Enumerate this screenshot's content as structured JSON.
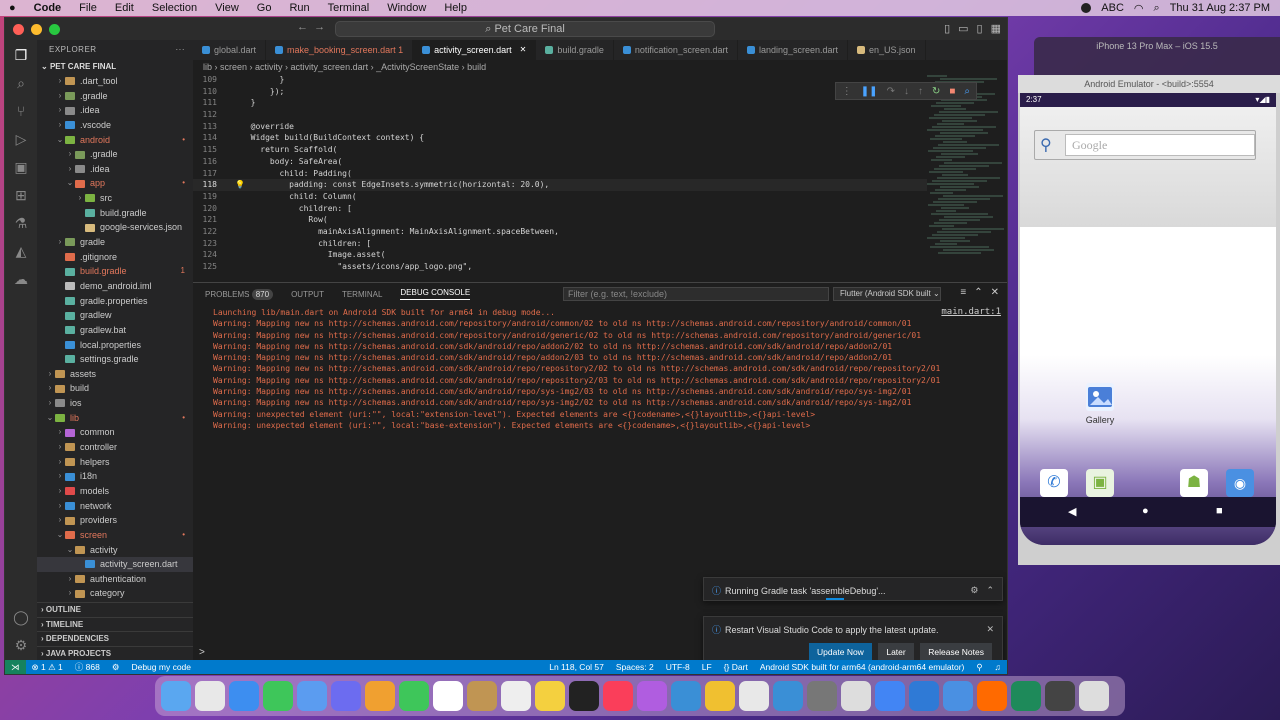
{
  "menubar": {
    "apple": "",
    "items": [
      "Code",
      "File",
      "Edit",
      "Selection",
      "View",
      "Go",
      "Run",
      "Terminal",
      "Window",
      "Help"
    ],
    "clock": "Thu 31 Aug  2:37 PM",
    "input_source": "ABC"
  },
  "window": {
    "title": "Pet Care Final"
  },
  "explorer": {
    "header": "EXPLORER",
    "project": "PET CARE FINAL",
    "items": [
      {
        "label": ".dart_tool",
        "indent": 1,
        "chev": "›",
        "color": "#c09553",
        "badge": ""
      },
      {
        "label": ".gradle",
        "indent": 1,
        "chev": "›",
        "color": "#7a9a5a",
        "badge": ""
      },
      {
        "label": ".idea",
        "indent": 1,
        "chev": "›",
        "color": "#8a8a8a",
        "badge": ""
      },
      {
        "label": ".vscode",
        "indent": 1,
        "chev": "›",
        "color": "#3a8fd6",
        "badge": ""
      },
      {
        "label": "android",
        "indent": 1,
        "chev": "⌄",
        "color": "#7cb342",
        "badge": "•",
        "labelColor": "#e2775c"
      },
      {
        "label": ".gradle",
        "indent": 2,
        "chev": "›",
        "color": "#7a9a5a",
        "badge": ""
      },
      {
        "label": ".idea",
        "indent": 2,
        "chev": "›",
        "color": "#8a8a8a",
        "badge": ""
      },
      {
        "label": "app",
        "indent": 2,
        "chev": "⌄",
        "color": "#e06c4b",
        "badge": "•",
        "labelColor": "#e2775c"
      },
      {
        "label": "src",
        "indent": 3,
        "chev": "›",
        "color": "#7cb342",
        "badge": ""
      },
      {
        "label": "build.gradle",
        "indent": 3,
        "chev": "",
        "color": "#5ab0a0",
        "badge": ""
      },
      {
        "label": "google-services.json",
        "indent": 3,
        "chev": "",
        "color": "#d7ba7d",
        "badge": ""
      },
      {
        "label": "gradle",
        "indent": 1,
        "chev": "›",
        "color": "#7a9a5a",
        "badge": ""
      },
      {
        "label": ".gitignore",
        "indent": 1,
        "chev": "",
        "color": "#e06c4b",
        "badge": ""
      },
      {
        "label": "build.gradle",
        "indent": 1,
        "chev": "",
        "color": "#5ab0a0",
        "badge": "1",
        "labelColor": "#e2775c"
      },
      {
        "label": "demo_android.iml",
        "indent": 1,
        "chev": "",
        "color": "#bbbbbb",
        "badge": ""
      },
      {
        "label": "gradle.properties",
        "indent": 1,
        "chev": "",
        "color": "#5ab0a0",
        "badge": ""
      },
      {
        "label": "gradlew",
        "indent": 1,
        "chev": "",
        "color": "#5ab0a0",
        "badge": ""
      },
      {
        "label": "gradlew.bat",
        "indent": 1,
        "chev": "",
        "color": "#5ab0a0",
        "badge": ""
      },
      {
        "label": "local.properties",
        "indent": 1,
        "chev": "",
        "color": "#3a8fd6",
        "badge": ""
      },
      {
        "label": "settings.gradle",
        "indent": 1,
        "chev": "",
        "color": "#5ab0a0",
        "badge": ""
      },
      {
        "label": "assets",
        "indent": 0,
        "chev": "›",
        "color": "#c09553",
        "badge": ""
      },
      {
        "label": "build",
        "indent": 0,
        "chev": "›",
        "color": "#c09553",
        "badge": ""
      },
      {
        "label": "ios",
        "indent": 0,
        "chev": "›",
        "color": "#8a8a8a",
        "badge": ""
      },
      {
        "label": "lib",
        "indent": 0,
        "chev": "⌄",
        "color": "#7cb342",
        "badge": "•",
        "labelColor": "#e2775c"
      },
      {
        "label": "common",
        "indent": 1,
        "chev": "›",
        "color": "#b565d6",
        "badge": ""
      },
      {
        "label": "controller",
        "indent": 1,
        "chev": "›",
        "color": "#c09553",
        "badge": ""
      },
      {
        "label": "helpers",
        "indent": 1,
        "chev": "›",
        "color": "#c09553",
        "badge": ""
      },
      {
        "label": "i18n",
        "indent": 1,
        "chev": "›",
        "color": "#3a8fd6",
        "badge": ""
      },
      {
        "label": "models",
        "indent": 1,
        "chev": "›",
        "color": "#e04a4a",
        "badge": ""
      },
      {
        "label": "network",
        "indent": 1,
        "chev": "›",
        "color": "#3a8fd6",
        "badge": ""
      },
      {
        "label": "providers",
        "indent": 1,
        "chev": "›",
        "color": "#c09553",
        "badge": ""
      },
      {
        "label": "screen",
        "indent": 1,
        "chev": "⌄",
        "color": "#e06c4b",
        "badge": "•",
        "labelColor": "#e2775c"
      },
      {
        "label": "activity",
        "indent": 2,
        "chev": "⌄",
        "color": "#c09553",
        "badge": ""
      },
      {
        "label": "activity_screen.dart",
        "indent": 3,
        "chev": "",
        "color": "#3a8fd6",
        "badge": "",
        "selected": true
      },
      {
        "label": "authentication",
        "indent": 2,
        "chev": "›",
        "color": "#c09553",
        "badge": ""
      },
      {
        "label": "category",
        "indent": 2,
        "chev": "›",
        "color": "#c09553",
        "badge": ""
      }
    ],
    "sections": [
      "OUTLINE",
      "TIMELINE",
      "DEPENDENCIES",
      "JAVA PROJECTS"
    ]
  },
  "tabs": [
    {
      "label": "global.dart",
      "active": false,
      "color": "#3a8fd6"
    },
    {
      "label": "make_booking_screen.dart 1",
      "active": false,
      "color": "#3a8fd6",
      "labelColor": "#e2775c"
    },
    {
      "label": "activity_screen.dart",
      "active": true,
      "color": "#3a8fd6"
    },
    {
      "label": "build.gradle",
      "active": false,
      "color": "#5ab0a0"
    },
    {
      "label": "notification_screen.dart",
      "active": false,
      "color": "#3a8fd6"
    },
    {
      "label": "landing_screen.dart",
      "active": false,
      "color": "#3a8fd6"
    },
    {
      "label": "en_US.json",
      "active": false,
      "color": "#d7ba7d"
    }
  ],
  "breadcrumbs": [
    "lib",
    "screen",
    "activity",
    "activity_screen.dart",
    "_ActivityScreenState",
    "build"
  ],
  "code": [
    {
      "n": "109",
      "t": "        }"
    },
    {
      "n": "110",
      "t": "      });"
    },
    {
      "n": "111",
      "t": "  }"
    },
    {
      "n": "112",
      "t": ""
    },
    {
      "n": "113",
      "t": "  @override"
    },
    {
      "n": "114",
      "t": "  Widget build(BuildContext context) {"
    },
    {
      "n": "115",
      "t": "    return Scaffold("
    },
    {
      "n": "116",
      "t": "      body: SafeArea("
    },
    {
      "n": "117",
      "t": "        child: Padding("
    },
    {
      "n": "118",
      "t": "          padding: const EdgeInsets.symmetric(horizontal: 20.0),",
      "cur": true
    },
    {
      "n": "119",
      "t": "          child: Column("
    },
    {
      "n": "120",
      "t": "            children: ["
    },
    {
      "n": "121",
      "t": "              Row("
    },
    {
      "n": "122",
      "t": "                mainAxisAlignment: MainAxisAlignment.spaceBetween,"
    },
    {
      "n": "123",
      "t": "                children: ["
    },
    {
      "n": "124",
      "t": "                  Image.asset("
    },
    {
      "n": "125",
      "t": "                    \"assets/icons/app_logo.png\","
    }
  ],
  "panel": {
    "tabs": [
      "PROBLEMS",
      "OUTPUT",
      "TERMINAL",
      "DEBUG CONSOLE"
    ],
    "problems_count": "870",
    "filter_placeholder": "Filter (e.g. text, !exclude)",
    "debug_target": "Flutter (Android SDK built",
    "main_link": "main.dart:1",
    "log": [
      "Launching lib/main.dart on Android SDK built for arm64 in debug mode...",
      "Warning: Mapping new ns http://schemas.android.com/repository/android/common/02 to old ns http://schemas.android.com/repository/android/common/01",
      "Warning: Mapping new ns http://schemas.android.com/repository/android/generic/02 to old ns http://schemas.android.com/repository/android/generic/01",
      "Warning: Mapping new ns http://schemas.android.com/sdk/android/repo/addon2/02 to old ns http://schemas.android.com/sdk/android/repo/addon2/01",
      "Warning: Mapping new ns http://schemas.android.com/sdk/android/repo/addon2/03 to old ns http://schemas.android.com/sdk/android/repo/addon2/01",
      "Warning: Mapping new ns http://schemas.android.com/sdk/android/repo/repository2/02 to old ns http://schemas.android.com/sdk/android/repo/repository2/01",
      "Warning: Mapping new ns http://schemas.android.com/sdk/android/repo/repository2/03 to old ns http://schemas.android.com/sdk/android/repo/repository2/01",
      "Warning: Mapping new ns http://schemas.android.com/sdk/android/repo/sys-img2/03 to old ns http://schemas.android.com/sdk/android/repo/sys-img2/01",
      "Warning: Mapping new ns http://schemas.android.com/sdk/android/repo/sys-img2/02 to old ns http://schemas.android.com/sdk/android/repo/sys-img2/01",
      "Warning: unexpected element (uri:\"\", local:\"extension-level\"). Expected elements are <{}codename>,<{}layoutlib>,<{}api-level>",
      "Warning: unexpected element (uri:\"\", local:\"base-extension\"). Expected elements are <{}codename>,<{}layoutlib>,<{}api-level>"
    ],
    "prompt": ">"
  },
  "notifications": {
    "gradle": "Running Gradle task 'assembleDebug'...",
    "update": "Restart Visual Studio Code to apply the latest update.",
    "update_now": "Update Now",
    "later": "Later",
    "release_notes": "Release Notes"
  },
  "statusbar": {
    "errors": "⊗ 1 ⚠ 1",
    "info": "ⓘ 868",
    "debug": "Debug my code",
    "position": "Ln 118, Col 57",
    "spaces": "Spaces: 2",
    "encoding": "UTF-8",
    "eol": "LF",
    "language": "{} Dart",
    "device": "Android SDK built for arm64 (android-arm64 emulator)"
  },
  "emulator": {
    "ios_title": "iPhone 13 Pro Max – iOS 15.5",
    "title": "Android Emulator - <build>:5554",
    "time": "2:37",
    "search_placeholder": "Google",
    "gallery": "Gallery"
  }
}
